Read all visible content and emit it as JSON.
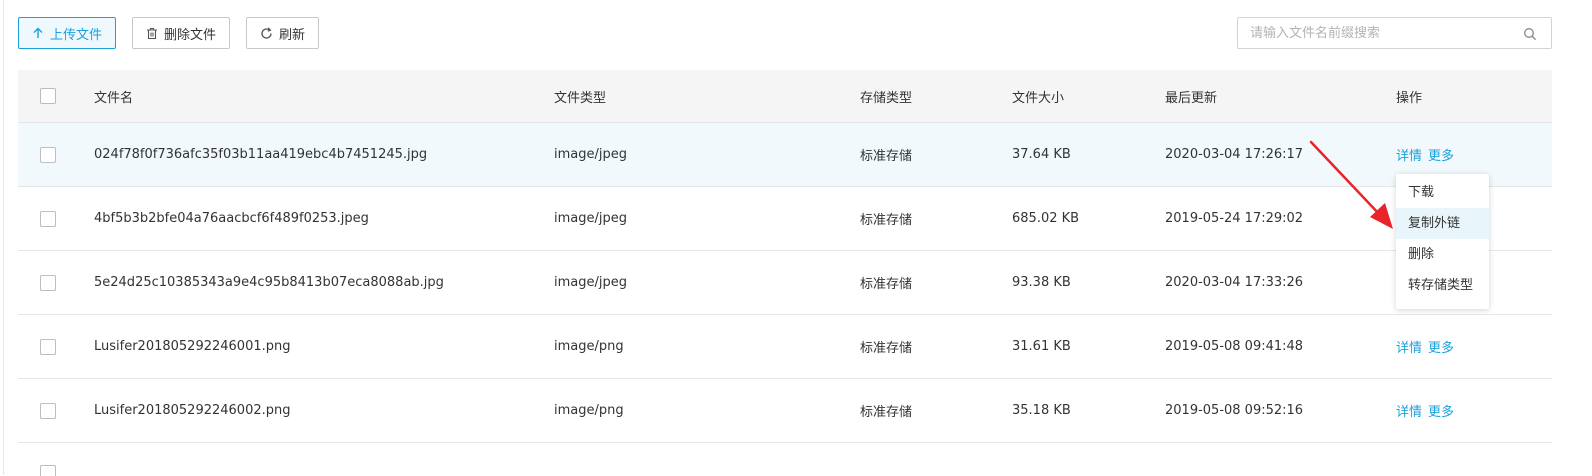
{
  "toolbar": {
    "upload_label": "上传文件",
    "delete_label": "删除文件",
    "refresh_label": "刷新"
  },
  "search": {
    "placeholder": "请输入文件名前缀搜索"
  },
  "table": {
    "columns": {
      "name": "文件名",
      "type": "文件类型",
      "storage": "存储类型",
      "size": "文件大小",
      "updated": "最后更新",
      "actions": "操作"
    },
    "rows": [
      {
        "name": "024f78f0f736afc35f03b11aa419ebc4b7451245.jpg",
        "type": "image/jpeg",
        "storage": "标准存储",
        "size": "37.64 KB",
        "updated": "2020-03-04 17:26:17",
        "detail": "详情",
        "more": "更多"
      },
      {
        "name": "4bf5b3b2bfe04a76aacbcf6f489f0253.jpeg",
        "type": "image/jpeg",
        "storage": "标准存储",
        "size": "685.02 KB",
        "updated": "2019-05-24 17:29:02"
      },
      {
        "name": "5e24d25c10385343a9e4c95b8413b07eca8088ab.jpg",
        "type": "image/jpeg",
        "storage": "标准存储",
        "size": "93.38 KB",
        "updated": "2020-03-04 17:33:26"
      },
      {
        "name": "Lusifer201805292246001.png",
        "type": "image/png",
        "storage": "标准存储",
        "size": "31.61 KB",
        "updated": "2019-05-08 09:41:48",
        "detail": "详情",
        "more": "更多"
      },
      {
        "name": "Lusifer201805292246002.png",
        "type": "image/png",
        "storage": "标准存储",
        "size": "35.18 KB",
        "updated": "2019-05-08 09:52:16",
        "detail": "详情",
        "more": "更多"
      }
    ]
  },
  "menu": {
    "items": [
      "下载",
      "复制外链",
      "删除",
      "转存储类型"
    ],
    "selected": "复制外链"
  },
  "colors": {
    "accent": "#1aa1dc",
    "annotation_arrow": "#e8242a",
    "row_highlight": "#f1f9fc"
  }
}
